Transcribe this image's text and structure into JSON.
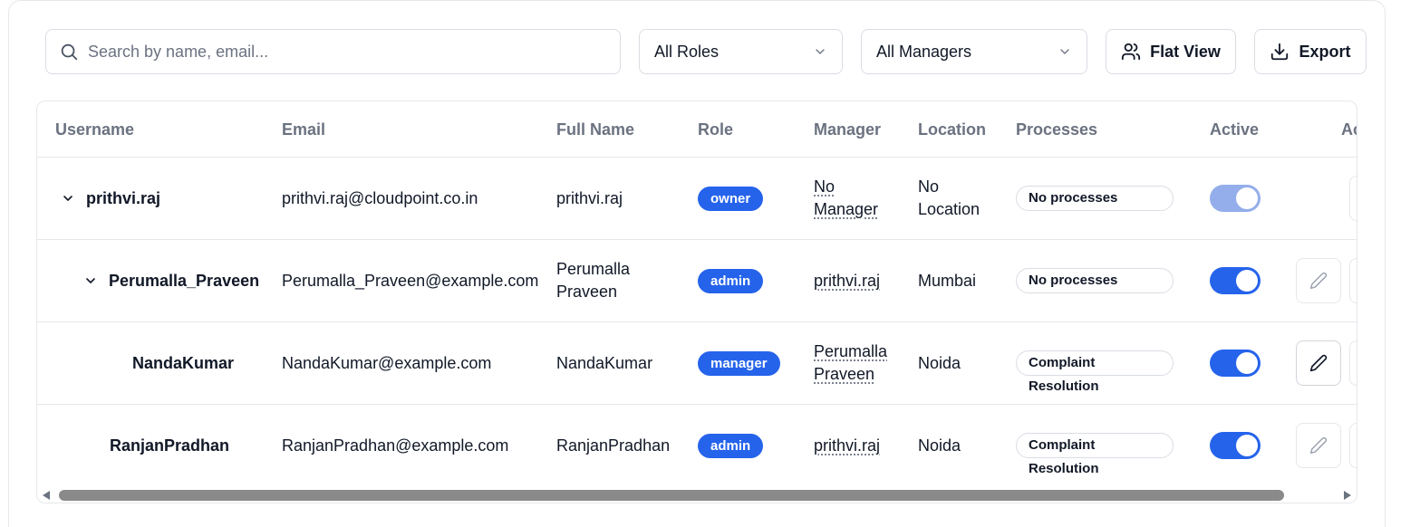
{
  "search": {
    "placeholder": "Search by name, email..."
  },
  "filters": {
    "roles_label": "All Roles",
    "managers_label": "All Managers"
  },
  "actions": {
    "flat_view_label": "Flat View",
    "export_label": "Export"
  },
  "table": {
    "columns": [
      "Username",
      "Email",
      "Full Name",
      "Role",
      "Manager",
      "Location",
      "Processes",
      "Active",
      "Ac"
    ],
    "rows": [
      {
        "username": "prithvi.raj",
        "expandable": true,
        "level": 0,
        "email": "prithvi.raj@cloudpoint.co.in",
        "full_name": "prithvi.raj",
        "role": "owner",
        "manager": "No Manager",
        "location": "No Location",
        "processes": "No processes",
        "active": true,
        "active_disabled": true
      },
      {
        "username": "Perumalla_Praveen",
        "expandable": true,
        "level": 1,
        "email": "Perumalla_Praveen@example.com",
        "full_name": "Perumalla Praveen",
        "role": "admin",
        "manager": "prithvi.raj",
        "location": "Mumbai",
        "processes": "No processes",
        "active": true
      },
      {
        "username": "NandaKumar",
        "expandable": false,
        "level": 2,
        "email": "NandaKumar@example.com",
        "full_name": "NandaKumar",
        "role": "manager",
        "manager": "Perumalla Praveen",
        "location": "Noida",
        "processes": "Complaint Resolution",
        "active": true
      },
      {
        "username": "RanjanPradhan",
        "expandable": false,
        "level": 1,
        "email": "RanjanPradhan@example.com",
        "full_name": "RanjanPradhan",
        "role": "admin",
        "manager": "prithvi.raj",
        "location": "Noida",
        "processes": "Complaint Resolution",
        "active": true
      }
    ]
  },
  "colors": {
    "accent": "#2563eb",
    "accent_disabled": "#93aeea",
    "border": "#e5e7eb",
    "muted_text": "#6b7280"
  },
  "icons": {
    "search": "search-icon",
    "chevron": "chevron-down-icon",
    "users": "users-icon",
    "download": "download-icon",
    "edit": "pencil-icon"
  }
}
